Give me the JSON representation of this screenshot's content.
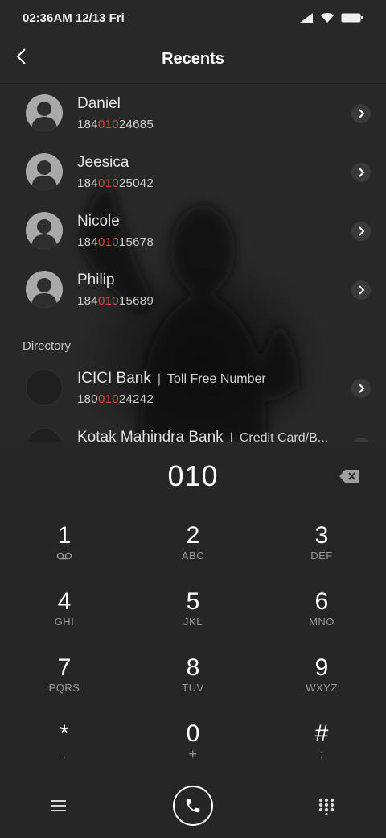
{
  "status_bar": {
    "time": "02:36AM 12/13 Fri"
  },
  "header": {
    "title": "Recents"
  },
  "recents": [
    {
      "name": "Daniel",
      "num_pre": "184",
      "num_match": "010",
      "num_post": "24685"
    },
    {
      "name": "Jeesica",
      "num_pre": "184",
      "num_match": "010",
      "num_post": "25042"
    },
    {
      "name": "Nicole",
      "num_pre": "184",
      "num_match": "010",
      "num_post": "15678"
    },
    {
      "name": "Philip",
      "num_pre": "184",
      "num_match": "010",
      "num_post": "15689"
    }
  ],
  "directory": {
    "label": "Directory",
    "items": [
      {
        "name": "ICICI Bank",
        "separator": "|",
        "tag": "Toll Free Number",
        "num_pre": "180",
        "num_match": "010",
        "num_post": "24242"
      },
      {
        "name": "Kotak Mahindra Bank",
        "separator": "|",
        "tag": "Credit Card/B..."
      }
    ]
  },
  "dialer": {
    "input": "010",
    "keys": [
      {
        "digit": "1",
        "sub": ""
      },
      {
        "digit": "2",
        "sub": "ABC"
      },
      {
        "digit": "3",
        "sub": "DEF"
      },
      {
        "digit": "4",
        "sub": "GHI"
      },
      {
        "digit": "5",
        "sub": "JKL"
      },
      {
        "digit": "6",
        "sub": "MNO"
      },
      {
        "digit": "7",
        "sub": "PQRS"
      },
      {
        "digit": "8",
        "sub": "TUV"
      },
      {
        "digit": "9",
        "sub": "WXYZ"
      },
      {
        "digit": "*",
        "sub": ","
      },
      {
        "digit": "0",
        "sub": "+"
      },
      {
        "digit": "#",
        "sub": ";"
      }
    ]
  },
  "icons": {
    "back": "back-arrow-icon",
    "chevron": "chevron-right-icon",
    "backspace": "backspace-icon",
    "voicemail": "voicemail-icon",
    "menu": "menu-icon",
    "call": "phone-icon",
    "keypad": "keypad-icon"
  },
  "colors": {
    "highlight": "#e0443a",
    "background": "#262626"
  }
}
